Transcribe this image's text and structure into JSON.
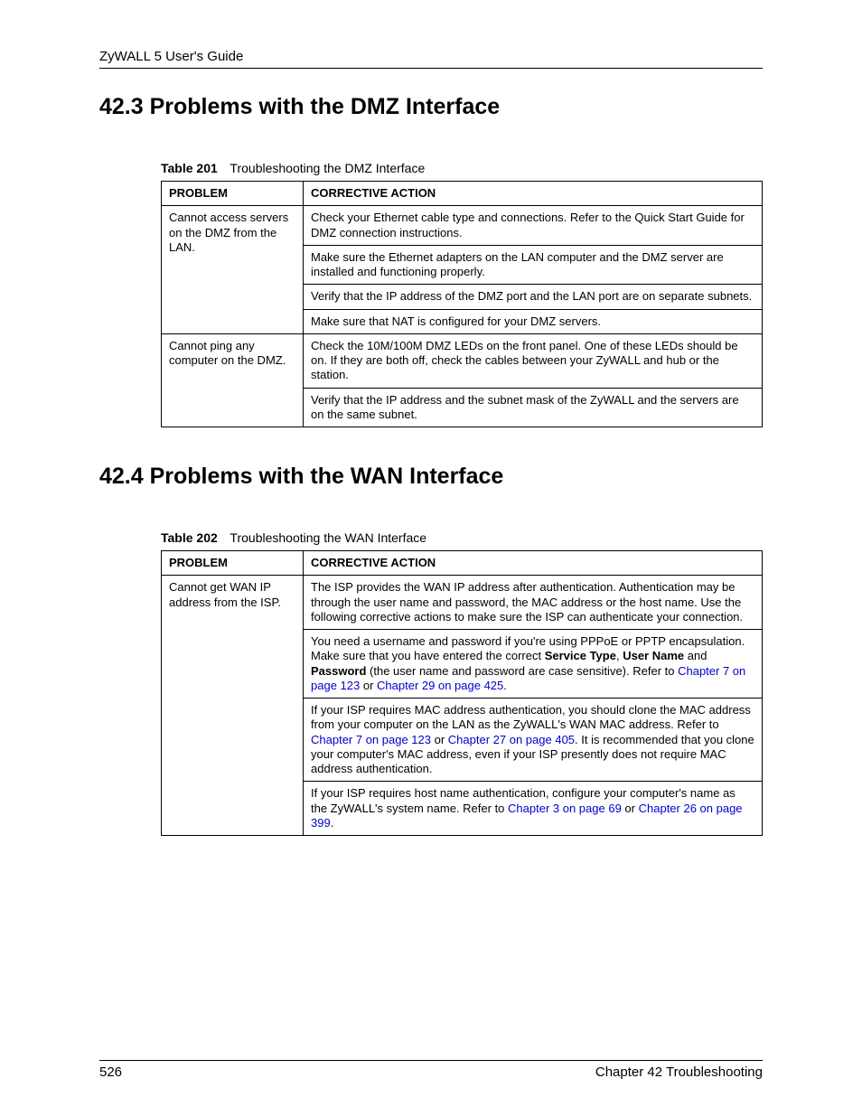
{
  "header": {
    "title": "ZyWALL 5 User's Guide"
  },
  "sections": {
    "s1": {
      "heading": "42.3  Problems with the DMZ Interface"
    },
    "s2": {
      "heading": "42.4  Problems with the WAN Interface"
    }
  },
  "tables": {
    "t1": {
      "caption_num": "Table 201",
      "caption_text": "Troubleshooting the DMZ Interface",
      "headers": {
        "c1": "PROBLEM",
        "c2": "CORRECTIVE ACTION"
      },
      "rows": [
        {
          "problem": "Cannot access servers on the DMZ from the LAN.",
          "actions": [
            "Check your Ethernet cable type and connections. Refer to the Quick Start Guide for DMZ connection instructions.",
            "Make sure the Ethernet adapters on the LAN computer and the DMZ server are installed and functioning properly.",
            "Verify that the IP address of the DMZ port and the LAN port are on separate subnets.",
            "Make sure that NAT is configured for your DMZ servers."
          ]
        },
        {
          "problem": "Cannot ping any computer on the DMZ.",
          "actions": [
            "Check the 10M/100M DMZ LEDs on the front panel. One of these LEDs should be on. If they are both off, check the cables between your ZyWALL and hub or the station.",
            "Verify that the IP address and the subnet mask of the ZyWALL and the servers are on the same subnet."
          ]
        }
      ]
    },
    "t2": {
      "caption_num": "Table 202",
      "caption_text": "Troubleshooting the WAN Interface",
      "headers": {
        "c1": "PROBLEM",
        "c2": "CORRECTIVE ACTION"
      },
      "rows": [
        {
          "problem": "Cannot get WAN IP address from the ISP.",
          "actions": [
            {
              "text": "The ISP provides the WAN IP address after authentication. Authentication may be through the user name and password, the MAC address or the host name. Use the following corrective actions to make sure the ISP can authenticate your connection."
            },
            {
              "pre1": "You need a username and password if you're using PPPoE or PPTP encapsulation. Make sure that you have entered the correct ",
              "b1": "Service Type",
              "mid1": ", ",
              "b2": "User Name",
              "mid2": " and ",
              "b3": "Password",
              "post1": " (the user name and password are case sensitive). Refer to ",
              "link1": "Chapter 7 on page 123",
              "mid3": " or ",
              "link2": "Chapter 29 on page 425",
              "post2": "."
            },
            {
              "pre1": "If your ISP requires MAC address authentication, you should clone the MAC address from your computer on the LAN as the ZyWALL's WAN MAC address. Refer to ",
              "link1": "Chapter 7 on page 123",
              "mid1": " or ",
              "link2": "Chapter 27 on page 405",
              "post1": ". It is recommended that you clone your computer's MAC address, even if your ISP presently does not require MAC address authentication."
            },
            {
              "pre1": "If your ISP requires host name authentication, configure your computer's name as the ZyWALL's system name. Refer to ",
              "link1": "Chapter 3 on page 69",
              "mid1": " or ",
              "link2": "Chapter 26 on page 399",
              "post1": "."
            }
          ]
        }
      ]
    }
  },
  "footer": {
    "pagenum": "526",
    "chapter": "Chapter 42 Troubleshooting"
  }
}
